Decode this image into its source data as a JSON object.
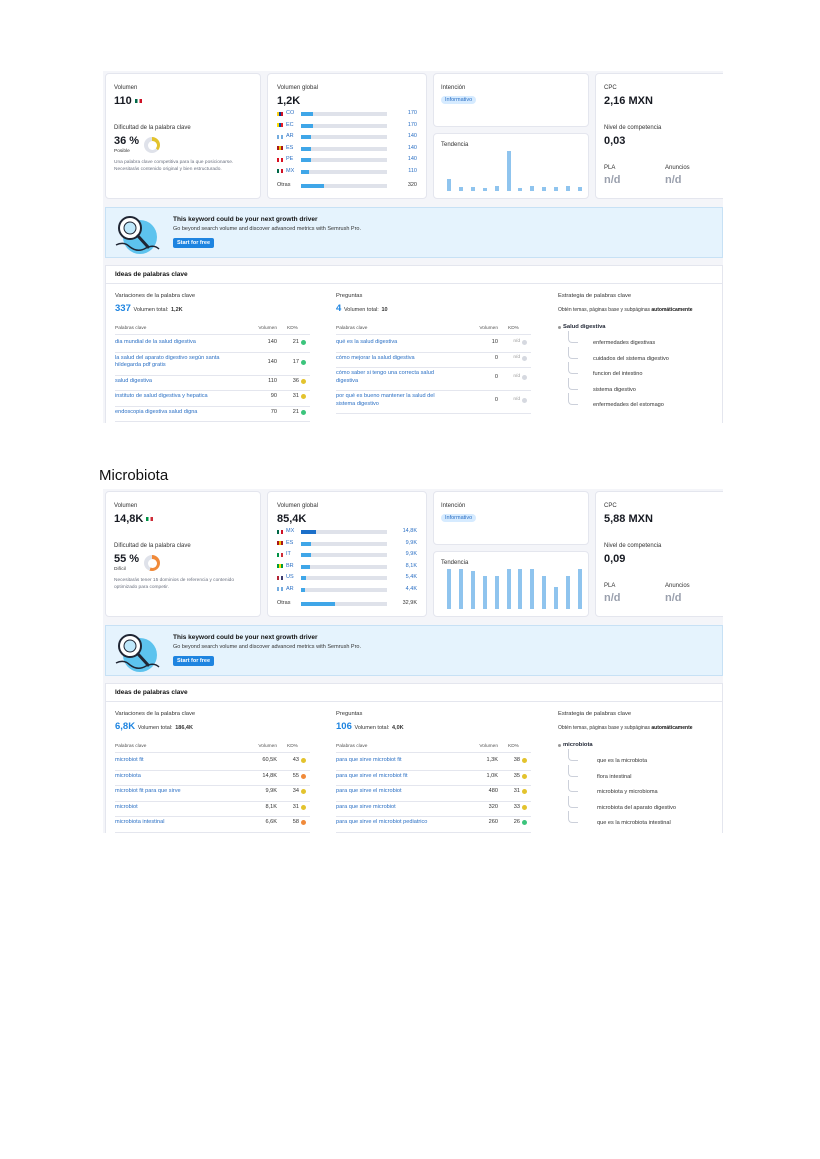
{
  "sections": [
    {
      "volume": {
        "label": "Volumen",
        "value": "110",
        "flag_colors": [
          "#006847",
          "#ffffff",
          "#ce1126"
        ]
      },
      "difficulty": {
        "label": "Dificultad de la palabra clave",
        "value": "36 %",
        "level": "Posible",
        "percent": 36,
        "color": "#e3c32d",
        "note": "Una palabra clave competitiva para la que posicionarse. Necesitarás contenido original y bien estructurado."
      },
      "global": {
        "label": "Volumen global",
        "value": "1,2K",
        "rows": [
          {
            "code": "CO",
            "value": "170",
            "fill": 0.14,
            "flag": [
              "#fcd116",
              "#003893",
              "#ce1126"
            ]
          },
          {
            "code": "EC",
            "value": "170",
            "fill": 0.14,
            "flag": [
              "#ffdd00",
              "#034ea2",
              "#ed1c24"
            ]
          },
          {
            "code": "AR",
            "value": "140",
            "fill": 0.12,
            "flag": [
              "#74acdf",
              "#ffffff",
              "#74acdf"
            ]
          },
          {
            "code": "ES",
            "value": "140",
            "fill": 0.12,
            "flag": [
              "#aa151b",
              "#f1bf00",
              "#aa151b"
            ]
          },
          {
            "code": "PE",
            "value": "140",
            "fill": 0.12,
            "flag": [
              "#d91023",
              "#ffffff",
              "#d91023"
            ]
          },
          {
            "code": "MX",
            "value": "110",
            "fill": 0.09,
            "flag": [
              "#006847",
              "#ffffff",
              "#ce1126"
            ]
          }
        ],
        "other": {
          "label": "Otras",
          "value": "320",
          "fill": 0.27
        }
      },
      "intent": {
        "label": "Intención",
        "badge": "Informativo"
      },
      "trend": {
        "label": "Tendencia",
        "values": [
          0.3,
          0.1,
          0.1,
          0.07,
          0.13,
          1.0,
          0.07,
          0.13,
          0.1,
          0.1,
          0.13,
          0.1
        ]
      },
      "cpc": {
        "label": "CPC",
        "value": "2,16 MXN"
      },
      "competition": {
        "label": "Nivel de competencia",
        "value": "0,03"
      },
      "pla": {
        "label": "PLA",
        "value": "n/d"
      },
      "ads": {
        "label": "Anuncios",
        "value": "n/d"
      },
      "banner": {
        "title": "This keyword could be your next growth driver",
        "subtitle": "Go beyond search volume and discover advanced metrics with Semrush Pro.",
        "button": "Start for free"
      },
      "ideas": {
        "title": "Ideas de palabras clave",
        "variations": {
          "header": "Variaciones de la palabra clave",
          "count": "337",
          "total_label": "Volumen total:",
          "total": "1,2K",
          "col_kw": "Palabras clave",
          "col_vol": "Volumen",
          "col_kd": "KD%",
          "rows": [
            {
              "kw": "dia mundial de la salud digestiva",
              "vol": "140",
              "kd": "21",
              "color": "#3cc47c"
            },
            {
              "kw": "la salud del aparato digestivo según santa hildegarda pdf gratis",
              "vol": "140",
              "kd": "17",
              "color": "#3cc47c"
            },
            {
              "kw": "salud digestiva",
              "vol": "110",
              "kd": "36",
              "color": "#e3c32d"
            },
            {
              "kw": "instituto de salud digestiva y hepatica",
              "vol": "90",
              "kd": "31",
              "color": "#e3c32d"
            },
            {
              "kw": "endoscopia digestiva salud digna",
              "vol": "70",
              "kd": "21",
              "color": "#3cc47c"
            }
          ]
        },
        "questions": {
          "header": "Preguntas",
          "count": "4",
          "total_label": "Volumen total:",
          "total": "10",
          "col_kw": "Palabras clave",
          "col_vol": "Volumen",
          "col_kd": "KD%",
          "rows": [
            {
              "kw": "qué es la salud digestiva",
              "vol": "10",
              "kd": "n/d",
              "color": "#d6d9e0"
            },
            {
              "kw": "cómo mejorar la salud digestiva",
              "vol": "0",
              "kd": "n/d",
              "color": "#d6d9e0"
            },
            {
              "kw": "cómo saber si tengo una correcta salud digestiva",
              "vol": "0",
              "kd": "n/d",
              "color": "#d6d9e0"
            },
            {
              "kw": "por qué es bueno mantener la salud del sistema digestivo",
              "vol": "0",
              "kd": "n/d",
              "color": "#d6d9e0"
            }
          ]
        },
        "strategy": {
          "header": "Estrategia de palabras clave",
          "desc": "Obtén temas, páginas base y subpáginas",
          "desc_bold": "automáticamente",
          "root": "Salud digestiva",
          "children": [
            "enfermedades digestivas",
            "cuidados del sistema digestivo",
            "funcion del intestino",
            "sistema digestivo",
            "enfermedades del estomago"
          ]
        }
      }
    },
    {
      "volume": {
        "label": "Volumen",
        "value": "14,8K",
        "flag_colors": [
          "#009246",
          "#ffffff",
          "#ce2b37"
        ]
      },
      "difficulty": {
        "label": "Dificultad de la palabra clave",
        "value": "55 %",
        "level": "Difícil",
        "percent": 55,
        "color": "#f08a3a",
        "note": "Necesitarás tener 15 dominios de referencia y contenido optimizado para competir."
      },
      "global": {
        "label": "Volumen global",
        "value": "85,4K",
        "rows": [
          {
            "code": "MX",
            "value": "14,8K",
            "fill": 0.17,
            "flag": [
              "#006847",
              "#ffffff",
              "#ce1126"
            ],
            "dark": true
          },
          {
            "code": "ES",
            "value": "9,9K",
            "fill": 0.12,
            "flag": [
              "#aa151b",
              "#f1bf00",
              "#aa151b"
            ]
          },
          {
            "code": "IT",
            "value": "9,9K",
            "fill": 0.12,
            "flag": [
              "#009246",
              "#ffffff",
              "#ce2b37"
            ]
          },
          {
            "code": "BR",
            "value": "8,1K",
            "fill": 0.1,
            "flag": [
              "#009c3b",
              "#ffdf00",
              "#009c3b"
            ]
          },
          {
            "code": "US",
            "value": "5,4K",
            "fill": 0.06,
            "flag": [
              "#b22234",
              "#ffffff",
              "#3c3b6e"
            ]
          },
          {
            "code": "AR",
            "value": "4,4K",
            "fill": 0.05,
            "flag": [
              "#74acdf",
              "#ffffff",
              "#74acdf"
            ]
          }
        ],
        "other": {
          "label": "Otras",
          "value": "32,9K",
          "fill": 0.39
        }
      },
      "intent": {
        "label": "Intención",
        "badge": "Informativo"
      },
      "trend": {
        "label": "Tendencia",
        "values": [
          1.0,
          1.0,
          0.95,
          0.82,
          0.82,
          1.0,
          1.0,
          1.0,
          0.82,
          0.55,
          0.82,
          1.0
        ]
      },
      "cpc": {
        "label": "CPC",
        "value": "5,88 MXN"
      },
      "competition": {
        "label": "Nivel de competencia",
        "value": "0,09"
      },
      "pla": {
        "label": "PLA",
        "value": "n/d"
      },
      "ads": {
        "label": "Anuncios",
        "value": "n/d"
      },
      "banner": {
        "title": "This keyword could be your next growth driver",
        "subtitle": "Go beyond search volume and discover advanced metrics with Semrush Pro.",
        "button": "Start for free"
      },
      "ideas": {
        "title": "Ideas de palabras clave",
        "variations": {
          "header": "Variaciones de la palabra clave",
          "count": "6,8K",
          "total_label": "Volumen total:",
          "total": "186,4K",
          "col_kw": "Palabras clave",
          "col_vol": "Volumen",
          "col_kd": "KD%",
          "rows": [
            {
              "kw": "microbiot fit",
              "vol": "60,5K",
              "kd": "43",
              "color": "#e3c32d"
            },
            {
              "kw": "microbiota",
              "vol": "14,8K",
              "kd": "55",
              "color": "#f08a3a"
            },
            {
              "kw": "microbiot fit para que sirve",
              "vol": "9,9K",
              "kd": "34",
              "color": "#e3c32d"
            },
            {
              "kw": "microbiot",
              "vol": "8,1K",
              "kd": "31",
              "color": "#e3c32d"
            },
            {
              "kw": "microbiota intestinal",
              "vol": "6,6K",
              "kd": "58",
              "color": "#f08a3a"
            }
          ]
        },
        "questions": {
          "header": "Preguntas",
          "count": "106",
          "total_label": "Volumen total:",
          "total": "4,0K",
          "col_kw": "Palabras clave",
          "col_vol": "Volumen",
          "col_kd": "KD%",
          "rows": [
            {
              "kw": "para que sirve microbiot fit",
              "vol": "1,3K",
              "kd": "38",
              "color": "#e3c32d"
            },
            {
              "kw": "para que sirve el microbiot fit",
              "vol": "1,0K",
              "kd": "35",
              "color": "#e3c32d"
            },
            {
              "kw": "para que sirve el microbiot",
              "vol": "480",
              "kd": "31",
              "color": "#e3c32d"
            },
            {
              "kw": "para que sirve microbiot",
              "vol": "320",
              "kd": "33",
              "color": "#e3c32d"
            },
            {
              "kw": "para que sirve el microbiot pediatrico",
              "vol": "260",
              "kd": "26",
              "color": "#3cc47c"
            }
          ]
        },
        "strategy": {
          "header": "Estrategia de palabras clave",
          "desc": "Obtén temas, páginas base y subpáginas",
          "desc_bold": "automáticamente",
          "root": "microbiota",
          "children": [
            "que es la microbiota",
            "flora intestinal",
            "microbiota y microbioma",
            "microbiota del aparato digestivo",
            "que es la microbiota intestinal"
          ]
        }
      }
    }
  ],
  "heading": "Microbiota"
}
